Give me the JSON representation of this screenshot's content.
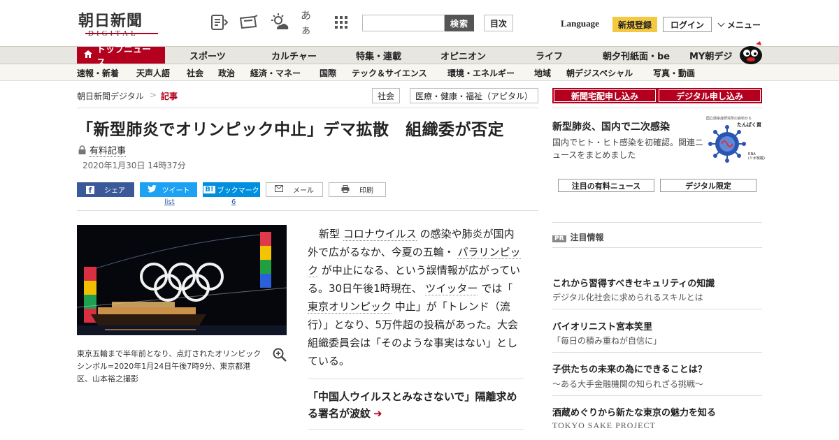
{
  "header": {
    "logo_jp": "朝日新聞",
    "logo_en": "DIGITAL",
    "search_button": "検索",
    "contents_button": "目次",
    "language": "Language",
    "register": "新規登録",
    "login": "ログイン",
    "menu": "メニュー",
    "font_size_glyph": "あぁ"
  },
  "nav_primary": [
    "トップニュース",
    "スポーツ",
    "カルチャー",
    "特集・連載",
    "オピニオン",
    "ライフ",
    "朝夕刊紙面・be",
    "MY朝デジ"
  ],
  "nav_secondary": [
    "速報・新着",
    "天声人語",
    "社会",
    "政治",
    "経済・マネー",
    "国際",
    "テック＆サイエンス",
    "環境・エネルギー",
    "地域",
    "朝デジスペシャル",
    "写真・動画"
  ],
  "breadcrumb": {
    "home": "朝日新聞デジタル",
    "sep": ">",
    "current": "記事"
  },
  "tags": [
    "社会",
    "医療・健康・福祉（アピタル）"
  ],
  "article": {
    "title": "「新型肺炎でオリンピック中止」デマ拡散　組織委が否定",
    "paid_label": "有料記事",
    "date": "2020年1月30日 14時37分",
    "share": {
      "facebook": "シェア",
      "twitter": "ツイート",
      "twitter_count": "list",
      "hatena": "ブックマーク",
      "hatena_count": "6",
      "mail": "メール",
      "print": "印刷"
    },
    "photo_caption": "東京五輪まで半年前となり、点灯されたオリンピックシンボル=2020年1月24日午後7時9分、東京都港区、山本裕之撮影",
    "body": {
      "p1": "新型",
      "l1": "コロナウイルス",
      "p2": "の感染や肺炎が国内外で広がるなか、今夏の五輪・",
      "l2": "パラリンピック",
      "p3": "が中止になる、という誤情報が広がっている。30日午後1時現在、",
      "l3": "ツイッター",
      "p4": "では「",
      "l4": "東京オリンピック",
      "p5": "中止」が「トレンド（流行）」となり、5万件超の投稿があった。大会組織委員会は「そのような事実はない」としている。"
    },
    "related_title": "「中国人ウイルスとみなさないで」隔離求める署名が波紋"
  },
  "sidebar": {
    "btn_paper": "新聞宅配申し込み",
    "btn_digital": "デジタル申し込み",
    "promo_title": "新型肺炎、国内で二次感染",
    "promo_desc": "国内でヒト・ヒト感染を初確認。関連ニュースをまとめました",
    "promo_img_top": "国立感染症研究所の資料から",
    "promo_img_label1": "たんぱく質",
    "promo_img_label2": "RNA\n(リボ核酸)",
    "tab1": "注目の有料ニュース",
    "tab2": "デジタル限定",
    "pr_badge": "PR",
    "pr_title": "注目情報",
    "pr_items": [
      {
        "title": "これから習得すべきセキュリティの知識",
        "sub": "デジタル化社会に求められるスキルとは"
      },
      {
        "title": "バイオリニスト宮本笑里",
        "sub": "「毎日の積み重ねが自信に」"
      },
      {
        "title": "子供たちの未来の為にできることは？",
        "sub": "～ある大手金融機関の知られざる挑戦～"
      },
      {
        "title": "酒蔵めぐりから新たな東京の魅力を知る",
        "sub": "TOKYO SAKE PROJECT"
      }
    ]
  },
  "colors": {
    "brand_red": "#b4001e",
    "register_yellow": "#f5c842",
    "facebook": "#3b5998",
    "twitter": "#1da1f2",
    "hatena": "#008fde"
  },
  "icons": [
    "news-icon",
    "paper-icon",
    "weather-icon",
    "font-size-icon",
    "grid-menu-icon",
    "home-icon",
    "lock-icon",
    "zoom-icon",
    "arrow-right-icon",
    "mascot-icon"
  ]
}
